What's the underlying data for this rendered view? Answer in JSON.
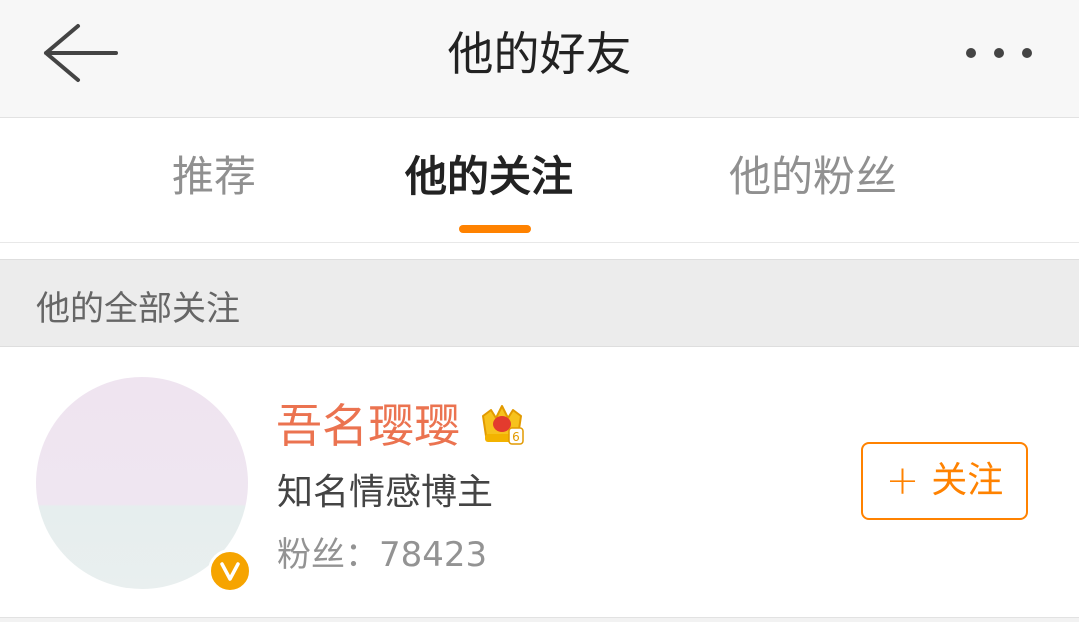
{
  "header": {
    "title": "他的好友",
    "back_icon": "arrow-left-icon",
    "more_icon": "more-dots-icon"
  },
  "tabs": [
    {
      "label": "推荐",
      "active": false
    },
    {
      "label": "他的关注",
      "active": true
    },
    {
      "label": "他的粉丝",
      "active": false
    }
  ],
  "section": {
    "title": "他的全部关注"
  },
  "users": [
    {
      "name": "吾名璎璎",
      "description": "知名情感博主",
      "fans_label": "粉丝：",
      "fans_count": "78423",
      "follow_label": "关注",
      "member_icon": "crown-badge-icon",
      "member_level": "6",
      "verified_icon": "verified-v-icon"
    }
  ],
  "colors": {
    "accent": "#ff8200",
    "username": "#eb7350",
    "verified": "#f6a400"
  }
}
